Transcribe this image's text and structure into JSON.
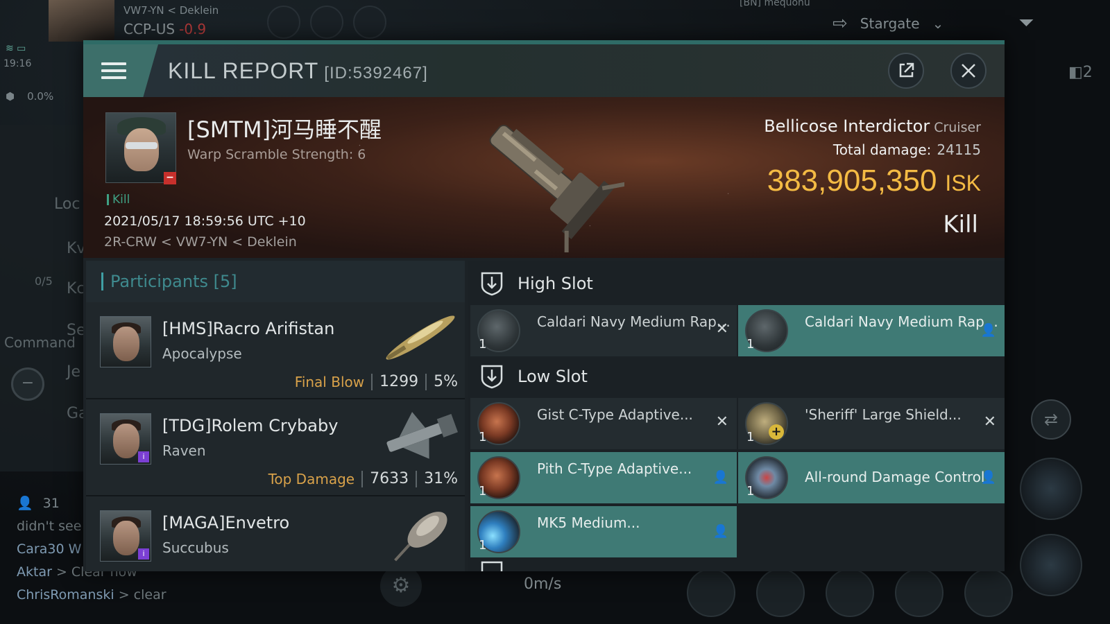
{
  "hud": {
    "location": "VW7-YN < Deklein",
    "server": "CCP-US",
    "security": "-0.9",
    "time": "19:16",
    "cargo_percent": "0.0%",
    "target_name": "[BN] mequonu",
    "destination": "Stargate",
    "side_count": "2",
    "left_labels": [
      "Loc",
      "Kv",
      "Kc",
      "Se",
      "Je",
      "Ga"
    ],
    "command_label": "Command",
    "fleet_count": "0/5",
    "chat_count": "31",
    "chat_lines": [
      {
        "name": "",
        "text": "didn't see"
      },
      {
        "name": "Cara30 W",
        "text": ""
      },
      {
        "name": "Aktar",
        "text": " > Clear now"
      },
      {
        "name": "ChrisRomanski",
        "text": " > clear"
      }
    ],
    "speed": "0m/s",
    "colors": {
      "accent": "#3f7a75",
      "isk": "#f4bb44",
      "security": "#b43a3a"
    }
  },
  "window": {
    "title": "KILL REPORT",
    "report_id": "[ID:5392467]",
    "share_icon": "share-icon",
    "close_icon": "close-icon"
  },
  "victim": {
    "name": "[SMTM]河马睡不醒",
    "subtitle": "Warp Scramble Strength: 6",
    "kill_tag": "Kill",
    "timestamp": "2021/05/17 18:59:56 UTC +10",
    "location": "2R-CRW < VW7-YN < Deklein",
    "ship": "Bellicose Interdictor",
    "ship_class": "Cruiser",
    "total_damage_label": "Total damage:",
    "total_damage": "24115",
    "isk_value": "383,905,350",
    "isk_unit": "ISK",
    "kill_type": "Kill"
  },
  "participants": {
    "header": "Participants [5]",
    "rows": [
      {
        "name": "[HMS]Racro Arifistan",
        "ship": "Apocalypse",
        "tag": "Final Blow",
        "damage": "1299",
        "percent": "5%"
      },
      {
        "name": "[TDG]Rolem Crybaby",
        "ship": "Raven",
        "tag": "Top Damage",
        "damage": "7633",
        "percent": "31%"
      },
      {
        "name": "[MAGA]Envetro",
        "ship": "Succubus",
        "tag": "",
        "damage": "",
        "percent": ""
      }
    ]
  },
  "fitting": {
    "high_slot_label": "High Slot",
    "low_slot_label": "Low Slot",
    "high": [
      {
        "qty": "1",
        "name": "Caldari Navy Medium Rapid ...",
        "status": "destroyed"
      },
      {
        "qty": "1",
        "name": "Caldari Navy Medium Rapid ...",
        "status": "dropped"
      }
    ],
    "low": [
      {
        "qty": "1",
        "name": "Gist C-Type Adaptive...",
        "status": "destroyed"
      },
      {
        "qty": "1",
        "name": "'Sheriff' Large Shield...",
        "status": "destroyed"
      },
      {
        "qty": "1",
        "name": "Pith C-Type Adaptive...",
        "status": "dropped"
      },
      {
        "qty": "1",
        "name": "All-round Damage Control",
        "status": "dropped"
      },
      {
        "qty": "1",
        "name": "MK5 Medium...",
        "status": "dropped"
      }
    ]
  }
}
